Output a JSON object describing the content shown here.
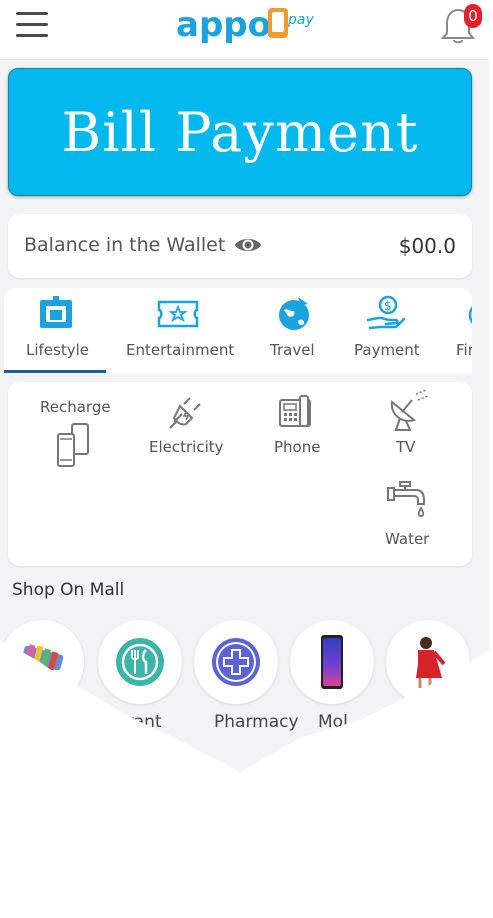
{
  "header": {
    "logo_text": "appo",
    "logo_sub": "pay",
    "notification_count": "0"
  },
  "banner": {
    "title": "Bill Payment"
  },
  "wallet": {
    "label": "Balance in the Wallet",
    "amount": "$00.0"
  },
  "tabs": [
    {
      "label": "Lifestyle",
      "icon": "lifestyle-icon",
      "selected": true
    },
    {
      "label": "Entertainment",
      "icon": "ticket-icon"
    },
    {
      "label": "Travel",
      "icon": "globe-icon"
    },
    {
      "label": "Payment",
      "icon": "payment-hand-icon"
    },
    {
      "label": "Fir",
      "icon": "finance-icon"
    }
  ],
  "services": [
    {
      "label": "Recharge",
      "icon": "mobile-recharge-icon"
    },
    {
      "label": "Electricity",
      "icon": "plug-icon"
    },
    {
      "label": "Phone",
      "icon": "landline-phone-icon"
    },
    {
      "label": "TV",
      "icon": "satellite-dish-icon"
    },
    {
      "label": "Water",
      "icon": "water-tap-icon"
    }
  ],
  "shop": {
    "title": "Shop On Mall",
    "items": [
      {
        "label": "",
        "icon": "groceries-icon"
      },
      {
        "label": "urant",
        "icon": "restaurant-icon"
      },
      {
        "label": "Pharmacy",
        "icon": "pharmacy-cross-icon"
      },
      {
        "label": "Mol",
        "icon": "mobile-phone-icon"
      },
      {
        "label": "",
        "icon": "fashion-icon"
      }
    ]
  },
  "colors": {
    "banner": "#02b8ec",
    "accent": "#1b5c9b",
    "icon_blue": "#1aa3dc",
    "pharmacy": "#5b63d6",
    "restaurant": "#3cb5a8",
    "badge": "#e4202a"
  }
}
